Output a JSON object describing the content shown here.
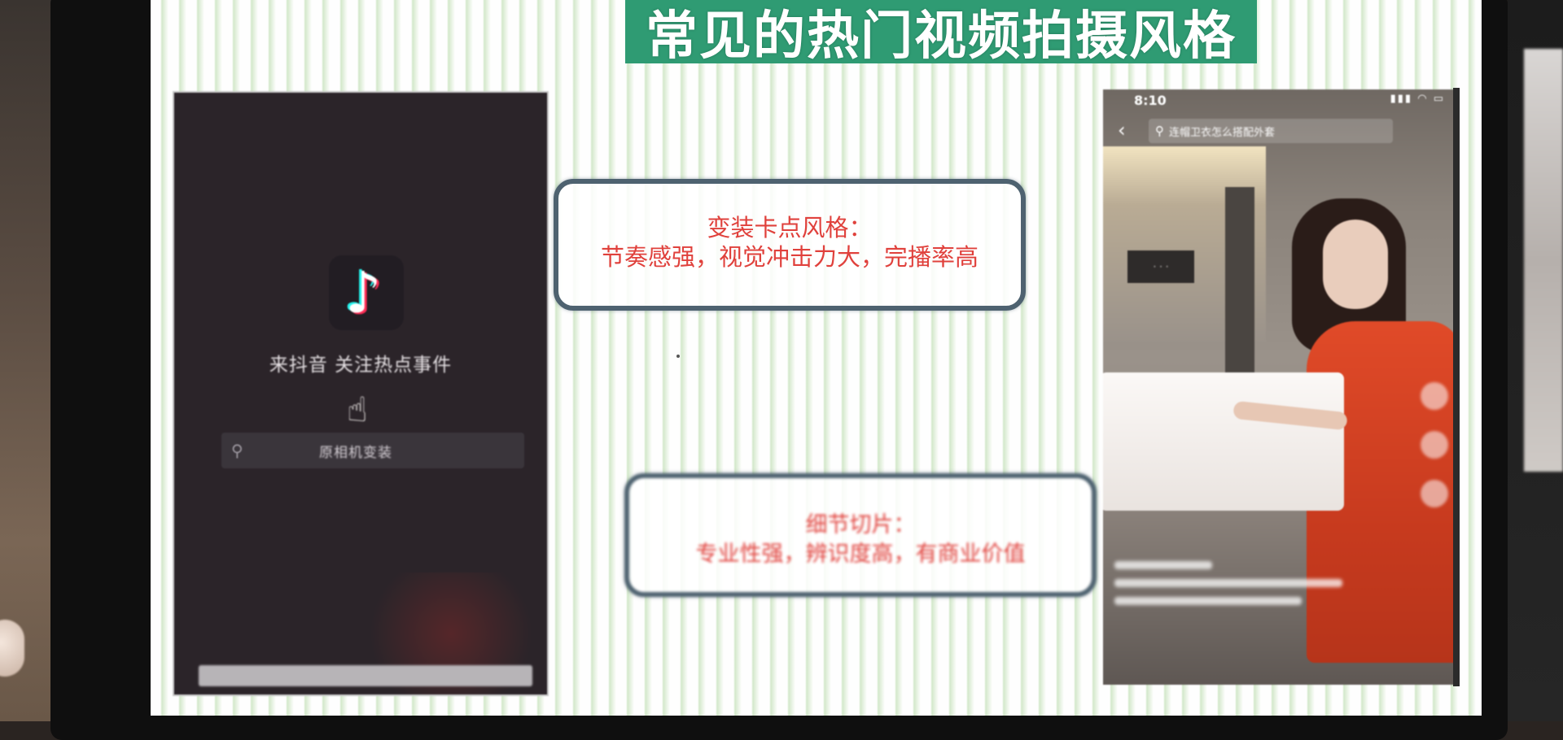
{
  "slide": {
    "title": "常见的热门视频拍摄风格"
  },
  "left_phone": {
    "slogan": "来抖音 关注热点事件",
    "search_text": "原相机变装"
  },
  "box_top": {
    "heading": "变装卡点风格：",
    "body": "节奏感强，视觉冲击力大，完播率高"
  },
  "box_bottom": {
    "heading": "细节切片：",
    "body": "专业性强，辨识度高，有商业价值"
  },
  "right_phone": {
    "time": "8:10",
    "search_query": "连帽卫衣怎么搭配外套"
  },
  "colors": {
    "title_band": "#2f9b73",
    "box_text": "#e0413c",
    "box_border": "#4e6270"
  },
  "icons": [
    "tiktok-logo-icon",
    "hand-cursor-icon",
    "search-icon",
    "back-icon",
    "signal-icon",
    "wifi-icon",
    "battery-icon"
  ]
}
